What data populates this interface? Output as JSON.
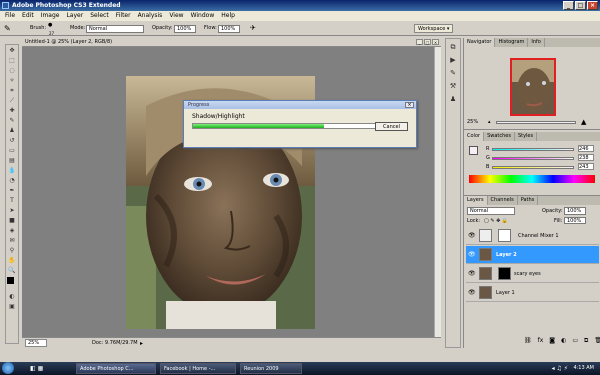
{
  "app": {
    "title": "Adobe Photoshop CS3 Extended"
  },
  "menu": [
    "File",
    "Edit",
    "Image",
    "Layer",
    "Select",
    "Filter",
    "Analysis",
    "View",
    "Window",
    "Help"
  ],
  "options": {
    "brush_label": "Brush:",
    "brush_size": "27",
    "mode_label": "Mode:",
    "mode_value": "Normal",
    "opacity_label": "Opacity:",
    "opacity_value": "100%",
    "flow_label": "Flow:",
    "flow_value": "100%",
    "workspace": "Workspace"
  },
  "document": {
    "title": "Untitled-1 @ 25% (Layer 2, RGB/8)",
    "zoom": "25%",
    "doc_size": "Doc: 9.76M/29.7M"
  },
  "dialog": {
    "title": "Progress",
    "label": "Shadow/Highlight",
    "progress": 0.72,
    "cancel": "Cancel"
  },
  "navigator": {
    "tabs": [
      "Navigator",
      "Histogram",
      "Info"
    ],
    "zoom": "25%"
  },
  "color_panel": {
    "tabs": [
      "Color",
      "Swatches",
      "Styles"
    ],
    "r_label": "R",
    "r_value": "246",
    "g_label": "G",
    "g_value": "238",
    "b_label": "B",
    "b_value": "243"
  },
  "layers_panel": {
    "tabs": [
      "Layers",
      "Channels",
      "Paths"
    ],
    "blend": "Normal",
    "opacity_label": "Opacity:",
    "opacity_value": "100%",
    "lock_label": "Lock:",
    "fill_label": "Fill:",
    "fill_value": "100%",
    "layers": [
      {
        "name": "Channel Mixer 1"
      },
      {
        "name": "Layer 2"
      },
      {
        "name": "scary eyes"
      },
      {
        "name": "Layer 1"
      }
    ]
  },
  "taskbar": {
    "items": [
      "Adobe Photoshop C...",
      "Facebook | Home -...",
      "Reunion 2009"
    ],
    "time": "4:13 AM"
  },
  "colors": {
    "accent": "#3399ff",
    "progress": "#22b022",
    "titlebar": "#0a246a"
  }
}
